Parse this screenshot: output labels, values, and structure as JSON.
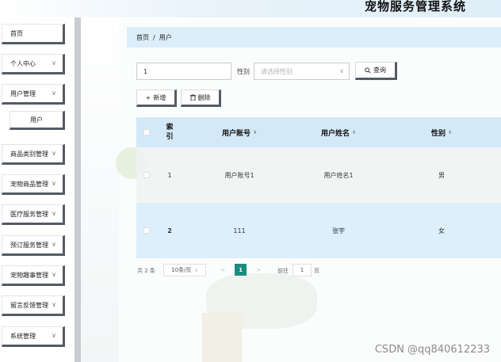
{
  "header": {
    "app_title": "宠物服务管理系统"
  },
  "sidebar": {
    "items": [
      {
        "label": "首页",
        "has_chevron": false
      },
      {
        "label": "个人中心",
        "chevron": "∨"
      },
      {
        "label": "用户管理",
        "chevron": "∨"
      },
      {
        "label": "商品类别管理",
        "chevron": "∨"
      },
      {
        "label": "宠物商品管理",
        "chevron": "∨"
      },
      {
        "label": "医疗服务管理",
        "chevron": "∨"
      },
      {
        "label": "预订服务管理",
        "chevron": "∨"
      },
      {
        "label": "宠物趣事管理",
        "chevron": "∨"
      },
      {
        "label": "留言反馈管理",
        "chevron": "∨"
      },
      {
        "label": "系统管理",
        "chevron": "∨"
      }
    ],
    "submenu": {
      "label": "用户"
    }
  },
  "breadcrumb": {
    "home": "首页",
    "separator": "/",
    "current": "用户"
  },
  "search": {
    "account_value": "1",
    "gender_label": "性别",
    "gender_placeholder": "请选择性别",
    "search_button": "查询"
  },
  "toolbar": {
    "add_button": "新增",
    "add_icon": "+",
    "delete_button": "删除"
  },
  "table": {
    "headers": {
      "index": "索引",
      "account": "用户账号",
      "name": "用户姓名",
      "gender": "性别",
      "sort_glyph": "⬍"
    },
    "rows": [
      {
        "index": "1",
        "account": "用户账号1",
        "name": "用户姓名1",
        "gender": "男"
      },
      {
        "index": "2",
        "account": "111",
        "name": "张宇",
        "gender": "女"
      }
    ]
  },
  "pagination": {
    "total": "共 2 条",
    "page_size": "10条/页",
    "prev": "<",
    "current_page": "1",
    "next": ">",
    "goto_label": "前往",
    "goto_value": "1",
    "page_suffix": "页"
  },
  "watermark": {
    "text": "CSDN @qq840612233"
  },
  "colors": {
    "accent": "#1a8c7e",
    "header_bg": "#d3e9f7",
    "breadcrumb_bg": "#dbeefa",
    "row_alt": "#dceffa"
  }
}
